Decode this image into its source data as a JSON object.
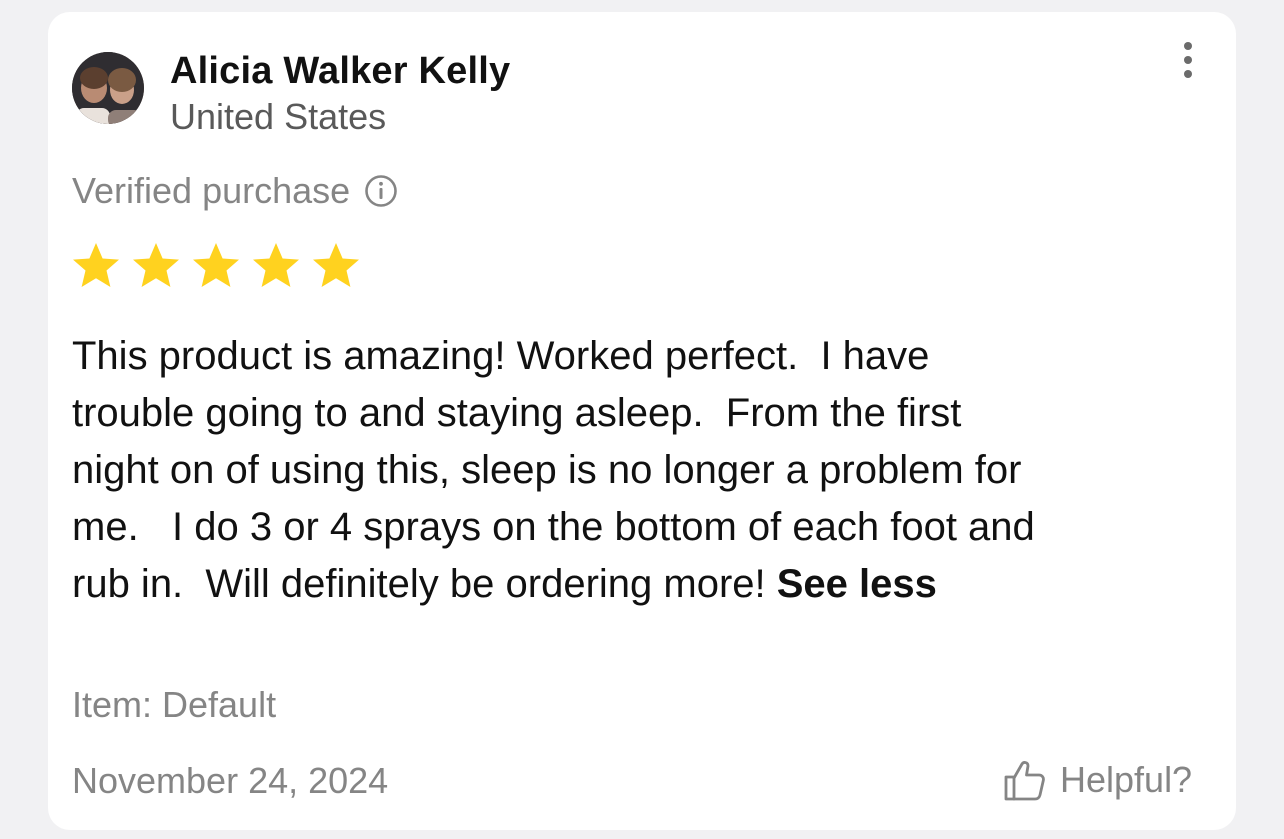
{
  "reviewer": {
    "name": "Alicia Walker Kelly",
    "location": "United States",
    "avatar_icon": "profile-photo"
  },
  "verified": {
    "label": "Verified purchase",
    "icon": "info-icon"
  },
  "rating": {
    "stars": 5,
    "max": 5,
    "color": "#FFD21F"
  },
  "review": {
    "lines": [
      "This product is amazing! Worked perfect.  I have",
      "trouble going to and staying asleep.  From the first",
      "night on of using this, sleep is no longer a problem for",
      "me.   I do 3 or 4 sprays on the bottom of each foot and",
      "rub in.  Will definitely be ordering more! "
    ],
    "toggle_label": "See less"
  },
  "item": {
    "label": "Item: Default"
  },
  "date": "November 24, 2024",
  "helpful": {
    "label": "Helpful?",
    "icon": "thumbs-up-icon"
  },
  "menu": {
    "icon": "more-vertical-icon"
  },
  "colors": {
    "background": "#F1F1F3",
    "card": "#FFFFFF",
    "primary_text": "#111111",
    "secondary_text": "#595959",
    "muted_text": "#858585",
    "star": "#FFD21F"
  }
}
